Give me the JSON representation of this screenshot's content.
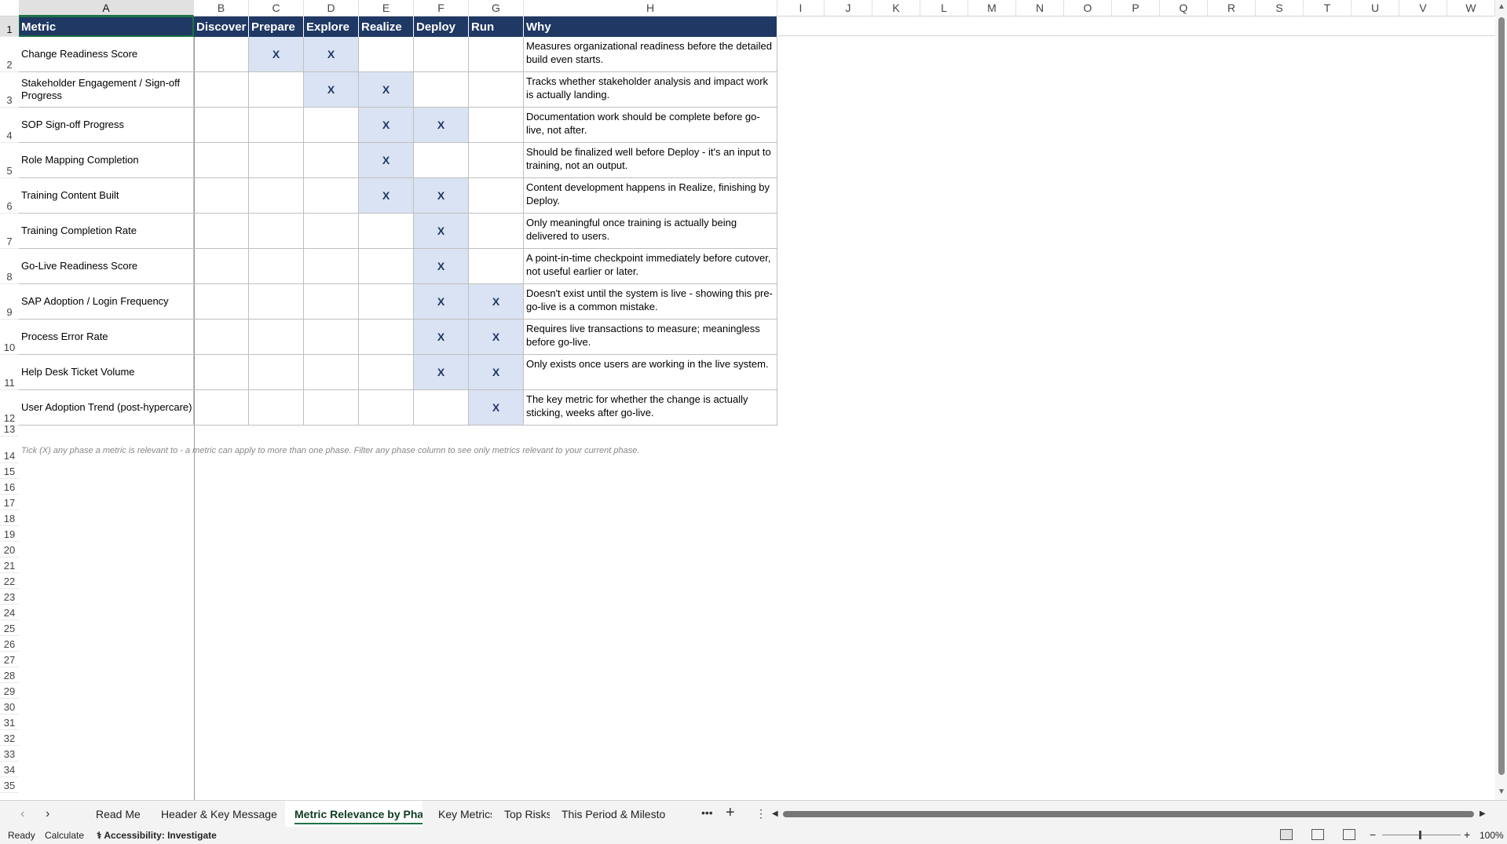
{
  "columns": [
    "A",
    "B",
    "C",
    "D",
    "E",
    "F",
    "G",
    "H",
    "I",
    "J",
    "K",
    "L",
    "M",
    "N",
    "O",
    "P",
    "Q",
    "R",
    "S",
    "T",
    "U",
    "V",
    "W"
  ],
  "rows": [
    "1",
    "2",
    "3",
    "4",
    "5",
    "6",
    "7",
    "8",
    "9",
    "10",
    "11",
    "12",
    "13",
    "14",
    "15",
    "16",
    "17",
    "18",
    "19",
    "20",
    "21",
    "22",
    "23",
    "24",
    "25",
    "26",
    "27",
    "28",
    "29",
    "30",
    "31",
    "32",
    "33",
    "34",
    "35"
  ],
  "table": {
    "headers": [
      "Metric",
      "Discover",
      "Prepare",
      "Explore",
      "Realize",
      "Deploy",
      "Run",
      "Why"
    ],
    "rows": [
      {
        "metric": "Change Readiness Score",
        "marks": [
          "",
          "X",
          "X",
          "",
          "",
          ""
        ],
        "why": "Measures organizational readiness before the detailed build even starts."
      },
      {
        "metric": "Stakeholder Engagement / Sign-off Progress",
        "marks": [
          "",
          "",
          "X",
          "X",
          "",
          ""
        ],
        "why": "Tracks whether stakeholder analysis and impact work is actually landing."
      },
      {
        "metric": "SOP Sign-off Progress",
        "marks": [
          "",
          "",
          "",
          "X",
          "X",
          ""
        ],
        "why": "Documentation work should be complete before go-live, not after."
      },
      {
        "metric": "Role Mapping Completion",
        "marks": [
          "",
          "",
          "",
          "X",
          "",
          ""
        ],
        "why": "Should be finalized well before Deploy - it's an input to training, not an output."
      },
      {
        "metric": "Training Content Built",
        "marks": [
          "",
          "",
          "",
          "X",
          "X",
          ""
        ],
        "why": "Content development happens in Realize, finishing by Deploy."
      },
      {
        "metric": "Training Completion Rate",
        "marks": [
          "",
          "",
          "",
          "",
          "X",
          ""
        ],
        "why": "Only meaningful once training is actually being delivered to users."
      },
      {
        "metric": "Go-Live Readiness Score",
        "marks": [
          "",
          "",
          "",
          "",
          "X",
          ""
        ],
        "why": "A point-in-time checkpoint immediately before cutover, not useful earlier or later."
      },
      {
        "metric": "SAP Adoption / Login Frequency",
        "marks": [
          "",
          "",
          "",
          "",
          "X",
          "X"
        ],
        "why": "Doesn't exist until the system is live - showing this pre-go-live is a common mistake."
      },
      {
        "metric": "Process Error Rate",
        "marks": [
          "",
          "",
          "",
          "",
          "X",
          "X"
        ],
        "why": "Requires live transactions to measure; meaningless before go-live."
      },
      {
        "metric": "Help Desk Ticket Volume",
        "marks": [
          "",
          "",
          "",
          "",
          "X",
          "X"
        ],
        "why": "Only exists once users are working in the live system."
      },
      {
        "metric": "User Adoption Trend (post-hypercare)",
        "marks": [
          "",
          "",
          "",
          "",
          "",
          "X"
        ],
        "why": "The key metric for whether the change is actually sticking, weeks after go-live."
      }
    ],
    "note": "Tick (X) any phase a metric is relevant to - a metric can apply to more than one phase. Filter any phase column to see only metrics relevant to your current phase."
  },
  "tabs": [
    "Read Me",
    "Header & Key Message",
    "Metric Relevance by Phase",
    "Key Metrics",
    "Top Risks",
    "This Period & Milesto"
  ],
  "active_tab": "Metric Relevance by Phase",
  "status": {
    "ready": "Ready",
    "calculate": "Calculate",
    "accessibility": "Accessibility: Investigate",
    "zoom": "100%"
  },
  "icons": {
    "more": "more-tabs-icon",
    "add": "add-sheet-icon"
  },
  "colors": {
    "header_bg": "#1f3864",
    "mark_bg": "#dae3f3",
    "accent": "#1e7145"
  }
}
